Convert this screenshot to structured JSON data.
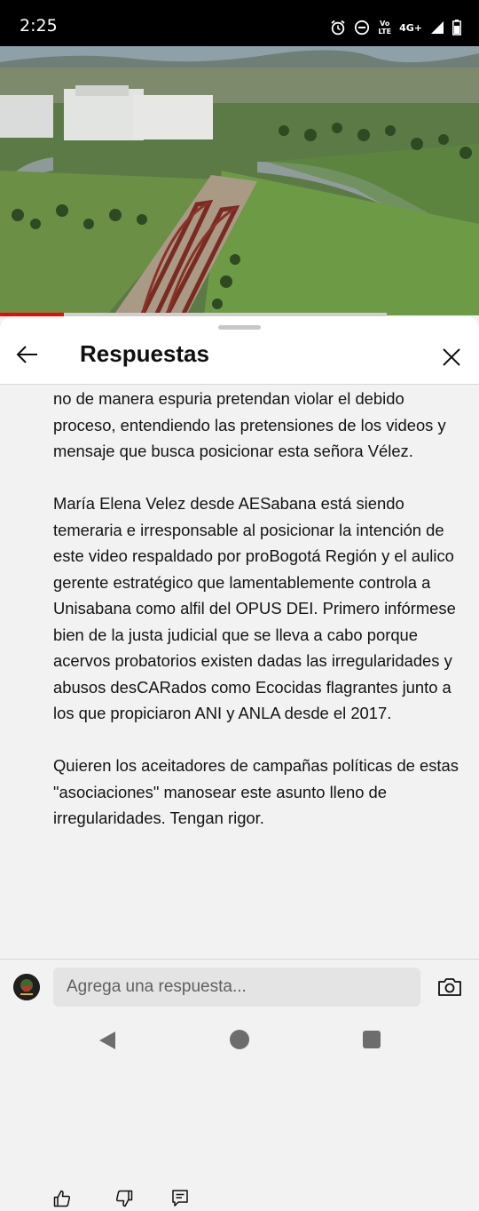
{
  "status_bar": {
    "time": "2:25",
    "network_label_top": "Vo",
    "network_label_bottom": "LTE",
    "network_type": "4G+"
  },
  "sheet": {
    "title": "Respuestas"
  },
  "comment": {
    "paragraphs": [
      "no de manera espuria pretendan violar el debido proceso, entendiendo las pretensiones de los videos y mensaje que busca posicionar esta señora Vélez.",
      "María Elena Velez desde AESabana está siendo temeraria e irresponsable al posicionar la intención de este video respaldado por proBogotá Región y el aulico gerente estratégico que lamentablemente controla a Unisabana como alfil del OPUS DEI. Primero infórmese bien de la justa judicial que se lleva a cabo porque acervos probatorios existen dadas las irregularidades y abusos desCARados como Ecocidas flagrantes junto a los que propiciaron ANI y ANLA desde el 2017.",
      "Quieren los aceitadores de campañas políticas de estas \"asociaciones\" manosear este asunto lleno de irregularidades. Tengan rigor."
    ]
  },
  "reply": {
    "placeholder": "Agrega una respuesta..."
  },
  "icons": {
    "back": "arrow-left-icon",
    "close": "close-icon",
    "like": "thumb-up-icon",
    "dislike": "thumb-down-icon",
    "reply": "comment-icon",
    "camera": "camera-icon"
  },
  "colors": {
    "progress": "#ff0000",
    "sheet_background": "#f2f2f2"
  },
  "video": {
    "progress_fraction": 0.13
  }
}
